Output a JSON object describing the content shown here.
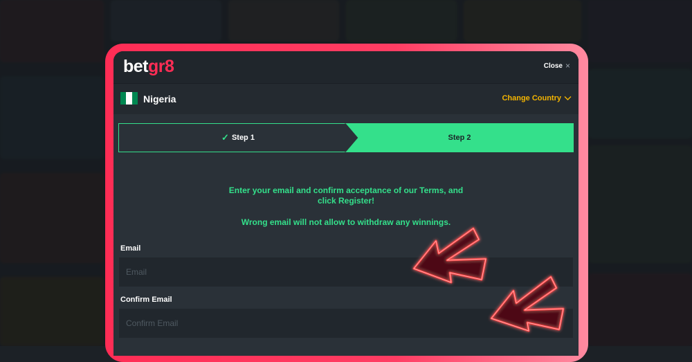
{
  "header": {
    "logo_prefix": "bet",
    "logo_accent": "gr8",
    "close_label": "Close",
    "close_icon": "×"
  },
  "country": {
    "name": "Nigeria",
    "change_label": "Change Country",
    "flag_colors": [
      "#008751",
      "#ffffff",
      "#008751"
    ]
  },
  "steps": [
    {
      "label": "Step 1",
      "state": "completed"
    },
    {
      "label": "Step 2",
      "state": "active"
    }
  ],
  "info": {
    "line1": "Enter your email and confirm acceptance of our Terms, and",
    "line2": "click Register!",
    "warning": "Wrong email will not allow to withdraw any winnings."
  },
  "form": {
    "email_label": "Email",
    "email_placeholder": "Email",
    "email_value": "",
    "confirm_label": "Confirm Email",
    "confirm_placeholder": "Confirm Email",
    "confirm_value": ""
  },
  "colors": {
    "accent_green": "#34e08b",
    "brand_red": "#ff2d55",
    "change_country": "#f4b400"
  }
}
